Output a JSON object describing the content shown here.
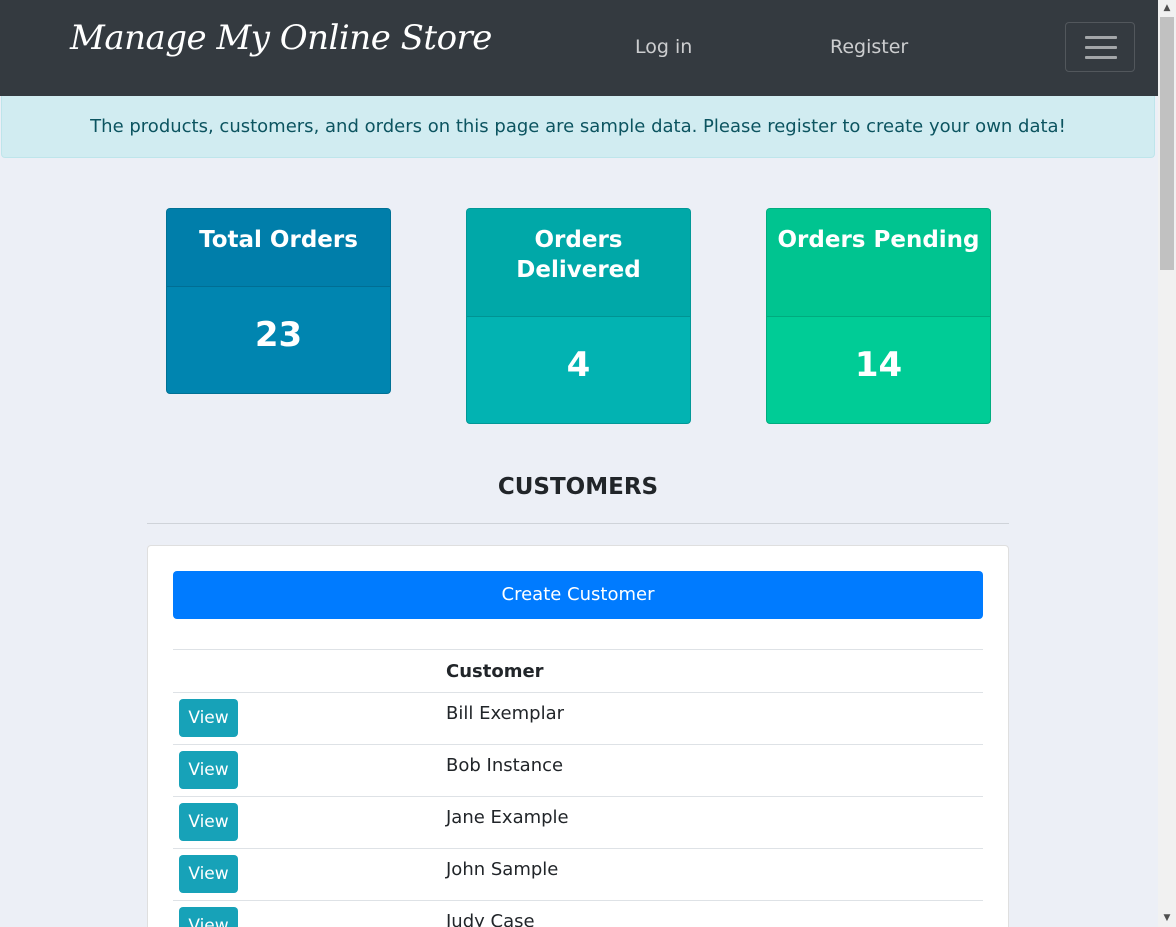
{
  "navbar": {
    "brand": "Manage My Online Store",
    "login": "Log in",
    "register": "Register",
    "menu_icon": "hamburger-icon"
  },
  "alert": {
    "text": "The products, customers, and orders on this page are sample data. Please register to create your own data!"
  },
  "stats": {
    "total": {
      "label": "Total Orders",
      "value": "23"
    },
    "delivered": {
      "label": "Orders Delivered",
      "value": "4"
    },
    "pending": {
      "label": "Orders Pending",
      "value": "14"
    }
  },
  "customers": {
    "title": "CUSTOMERS",
    "create_label": "Create Customer",
    "column_header": "Customer",
    "view_label": "View",
    "rows": [
      {
        "name": "Bill Exemplar"
      },
      {
        "name": "Bob Instance"
      },
      {
        "name": "Jane Example"
      },
      {
        "name": "John Sample"
      },
      {
        "name": "Judy Case"
      }
    ]
  },
  "colors": {
    "navbar": "#343a40",
    "primary": "#007bff",
    "info": "#17a2b8",
    "total": "#0085b0",
    "delivered": "#02b3b2",
    "pending": "#00cc96"
  }
}
